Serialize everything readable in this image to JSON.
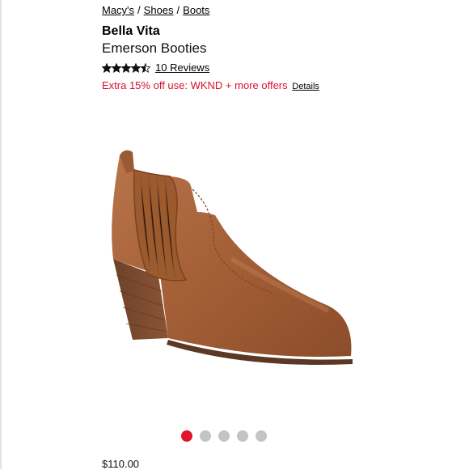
{
  "breadcrumb": {
    "items": [
      "Macy's",
      "Shoes",
      "Boots"
    ],
    "separator": "/"
  },
  "product": {
    "brand": "Bella Vita",
    "name": "Emerson Booties",
    "rating_stars": 4.5,
    "rating_max": 5,
    "reviews_label": "10 Reviews",
    "price": "$110.00",
    "image_icon": "brown-leather-ankle-bootie"
  },
  "promo": {
    "text": "Extra 15% off use: WKND + more offers",
    "details_label": "Details",
    "color": "#d8102f"
  },
  "carousel": {
    "count": 5,
    "active_index": 0,
    "active_color": "#e3132d",
    "inactive_color": "#c4c4c4"
  }
}
